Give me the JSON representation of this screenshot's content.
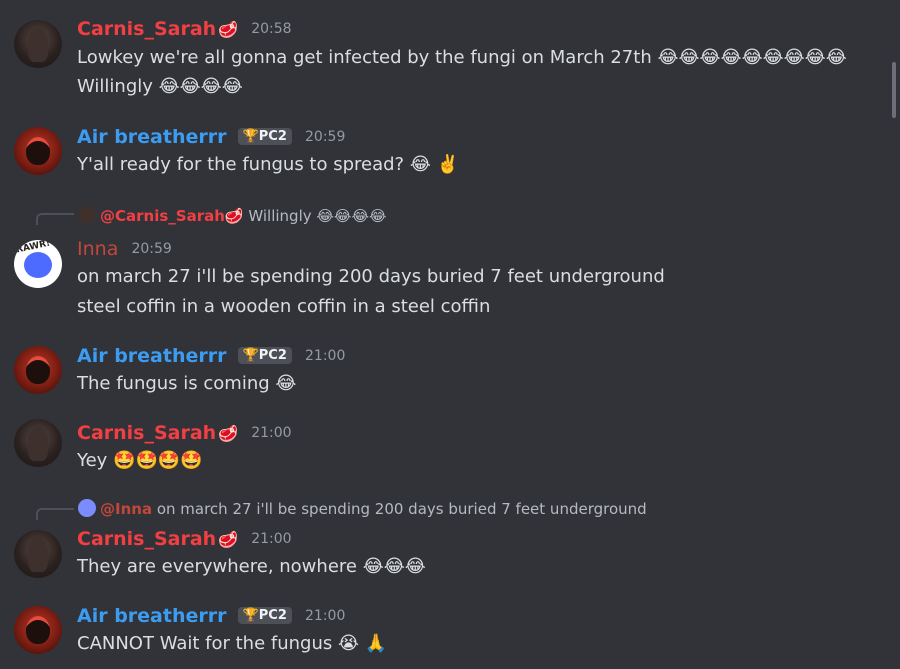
{
  "messages": [
    {
      "author": "Carnis_Sarah",
      "author_emoji": "🥩",
      "time": "20:58",
      "lines": [
        "Lowkey we're all gonna get infected by the fungi on March 27th 😂😂😂😂😂😂😂😂😂",
        "Willingly 😂😂😂😂"
      ]
    },
    {
      "author": "Air breatherrr",
      "badge": "🏆PC2",
      "time": "20:59",
      "lines": [
        "Y'all ready for the fungus to spread? 😂 ✌️"
      ]
    },
    {
      "reply": {
        "name": "@Carnis_Sarah",
        "name_emoji": "🥩",
        "text": "Willingly 😂😂😂😂"
      },
      "author": "Inna",
      "time": "20:59",
      "lines": [
        "on march 27 i'll be spending 200 days buried 7 feet underground",
        "steel coffin in a wooden coffin in a steel coffin"
      ]
    },
    {
      "author": "Air breatherrr",
      "badge": "🏆PC2",
      "time": "21:00",
      "lines": [
        "The fungus is coming 😂"
      ]
    },
    {
      "author": "Carnis_Sarah",
      "author_emoji": "🥩",
      "time": "21:00",
      "lines": [
        "Yey 🤩🤩🤩🤩"
      ]
    },
    {
      "reply": {
        "name": "@Inna",
        "text": "on march 27 i'll be spending 200 days buried 7 feet underground"
      },
      "author": "Carnis_Sarah",
      "author_emoji": "🥩",
      "time": "21:00",
      "lines": [
        "They are everywhere, nowhere 😂😂😂"
      ]
    },
    {
      "author": "Air breatherrr",
      "badge": "🏆PC2",
      "time": "21:00",
      "lines": [
        "CANNOT Wait for the fungus 😭 🙏"
      ]
    }
  ],
  "inna_avatar_text": "RAWR!",
  "colors": {
    "background": "#313338",
    "carnis_name": "#f23f43",
    "air_name": "#3b9cf2",
    "inna_name": "#c2473b",
    "timestamp": "#949ba4"
  }
}
